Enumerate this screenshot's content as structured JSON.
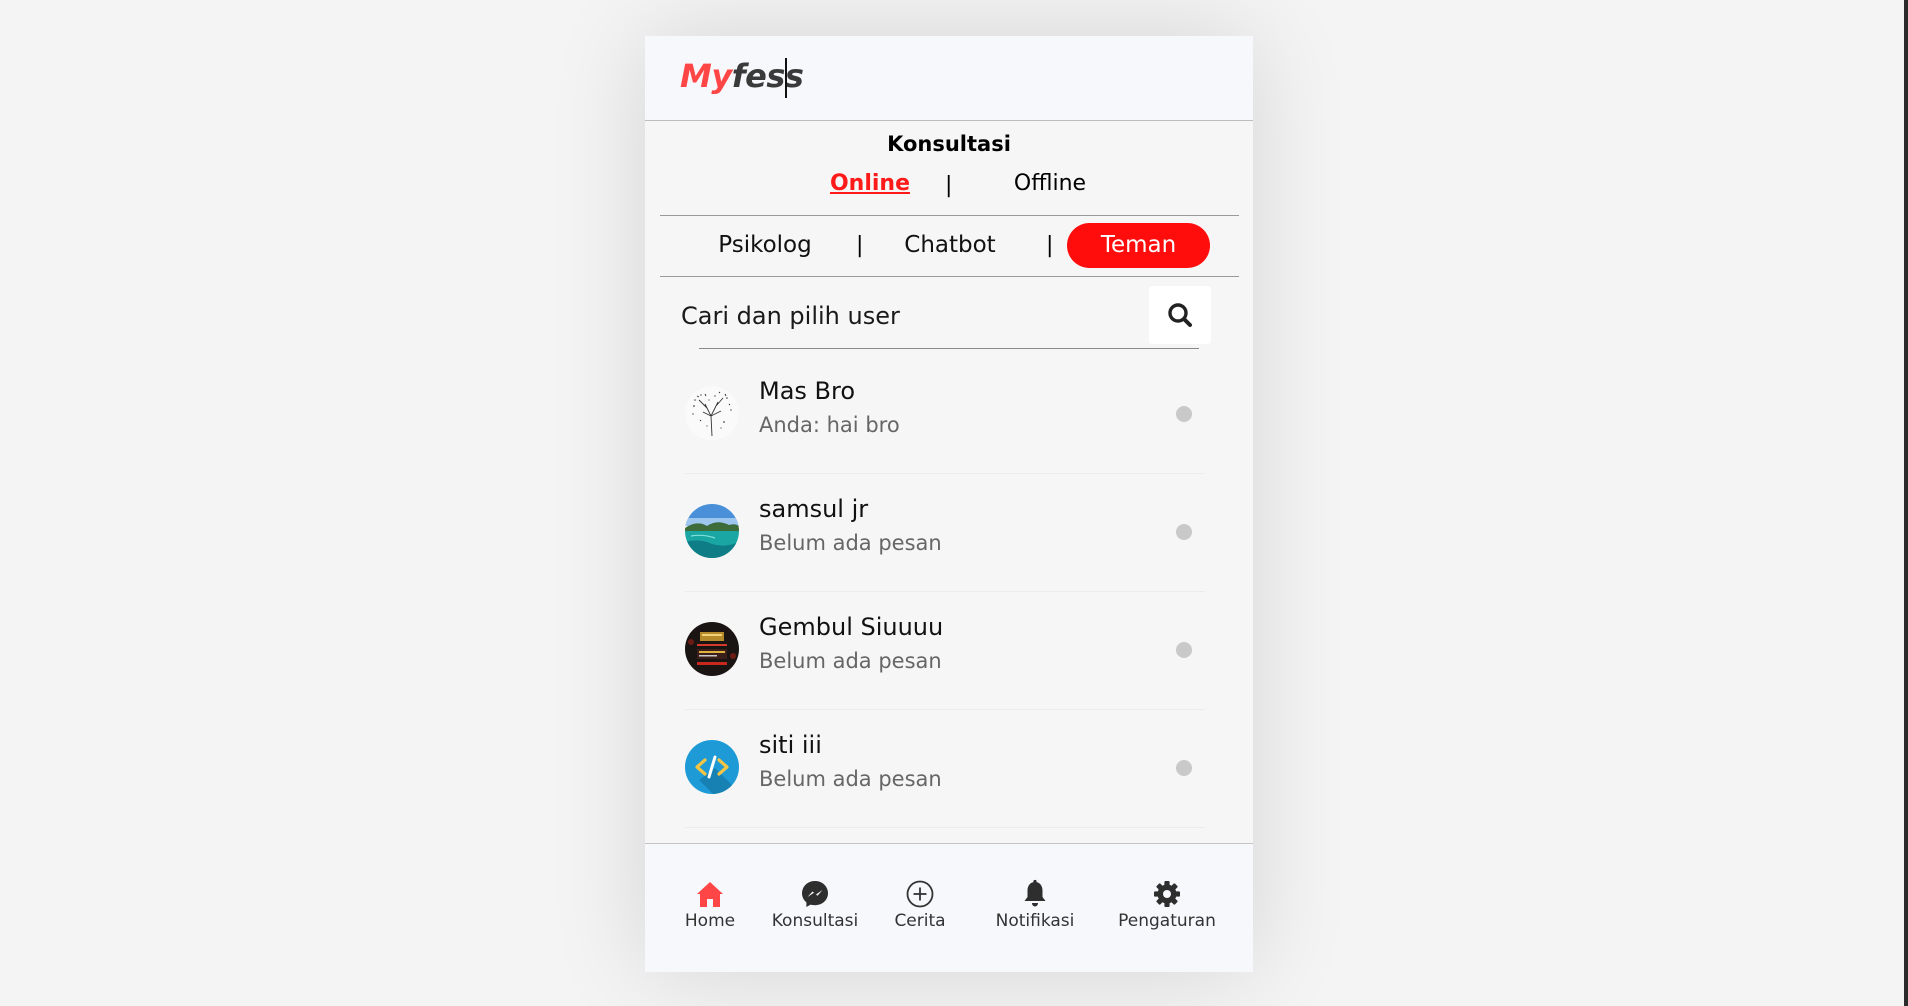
{
  "app": {
    "logo_part1": "My",
    "logo_part2": "fess",
    "brand_red": "#ff1a1a"
  },
  "section": {
    "title": "Konsultasi",
    "modes": [
      {
        "label": "Online",
        "active": true
      },
      {
        "label": "Offline",
        "active": false
      }
    ],
    "mode_separator": "|"
  },
  "tabs": {
    "items": [
      {
        "label": "Psikolog",
        "active": false
      },
      {
        "label": "Chatbot",
        "active": false
      },
      {
        "label": "Teman",
        "active": true
      }
    ],
    "separator": "|"
  },
  "search": {
    "placeholder": "Cari dan pilih user",
    "icon": "search-icon"
  },
  "users": [
    {
      "name": "Mas Bro",
      "preview": "Anda: hai bro",
      "avatar": "sketch-tree-avatar",
      "status": "offline"
    },
    {
      "name": "samsul jr",
      "preview": "Belum ada pesan",
      "avatar": "island-sea-avatar",
      "status": "offline"
    },
    {
      "name": "Gembul Siuuuu",
      "preview": "Belum ada pesan",
      "avatar": "dark-poster-avatar",
      "status": "offline"
    },
    {
      "name": "siti iii",
      "preview": "Belum ada pesan",
      "avatar": "code-tag-avatar",
      "status": "offline"
    }
  ],
  "bottom_nav": {
    "items": [
      {
        "label": "Home",
        "icon": "home-icon",
        "active": true
      },
      {
        "label": "Konsultasi",
        "icon": "messenger-icon",
        "active": false
      },
      {
        "label": "Cerita",
        "icon": "plus-circle-icon",
        "active": false
      },
      {
        "label": "Notifikasi",
        "icon": "bell-icon",
        "active": false
      },
      {
        "label": "Pengaturan",
        "icon": "gear-icon",
        "active": false
      }
    ]
  }
}
